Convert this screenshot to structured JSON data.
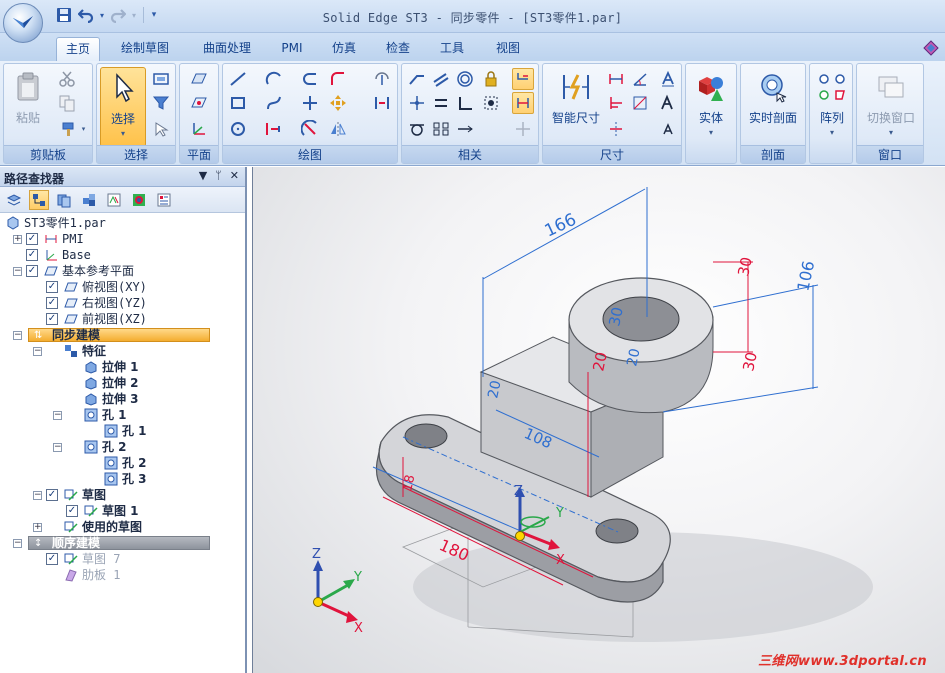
{
  "window": {
    "title": "Solid Edge ST3 - 同步零件 - [ST3零件1.par]"
  },
  "tabs": [
    {
      "label": "主页",
      "active": true
    },
    {
      "label": "绘制草图"
    },
    {
      "label": "曲面处理"
    },
    {
      "label": "PMI"
    },
    {
      "label": "仿真"
    },
    {
      "label": "检查"
    },
    {
      "label": "工具"
    },
    {
      "label": "视图"
    }
  ],
  "ribbon": {
    "clipboard": {
      "label": "剪贴板",
      "paste": "粘贴"
    },
    "select": {
      "label": "选择",
      "select": "选择"
    },
    "plane": {
      "label": "平面"
    },
    "draw": {
      "label": "绘图"
    },
    "relate": {
      "label": "相关"
    },
    "dimension": {
      "label": "尺寸",
      "smart": "智能尺寸"
    },
    "solid": {
      "label": "实体"
    },
    "section": {
      "label": "剖面",
      "live": "实时剖面"
    },
    "pattern": {
      "label": "阵列"
    },
    "window": {
      "label": "窗口",
      "switch": "切换窗口"
    }
  },
  "pathfinder": {
    "title": "路径查找器",
    "controls": [
      "▼",
      "ᛘ",
      "✕"
    ],
    "tree": [
      {
        "label": "ST3零件1.par",
        "indent": 0,
        "icon": "part-icon"
      },
      {
        "label": "PMI",
        "indent": 1,
        "exp": "+",
        "check": true,
        "icon": "pmi-icon"
      },
      {
        "label": "Base",
        "indent": 1,
        "check": true,
        "icon": "coord-icon"
      },
      {
        "label": "基本参考平面",
        "indent": 1,
        "exp": "−",
        "check": true,
        "icon": "plane-icon"
      },
      {
        "label": "俯视图(XY)",
        "indent": 2,
        "check": true,
        "icon": "plane-icon"
      },
      {
        "label": "右视图(YZ)",
        "indent": 2,
        "check": true,
        "icon": "plane-icon"
      },
      {
        "label": "前视图(XZ)",
        "indent": 2,
        "check": true,
        "icon": "plane-icon"
      },
      {
        "label": "同步建模",
        "indent": 1,
        "exp": "−",
        "band": "sync"
      },
      {
        "label": "特征",
        "indent": 2,
        "exp": "−",
        "icon": "features-icon",
        "bold": true
      },
      {
        "label": "拉伸 1",
        "indent": 3,
        "icon": "extrude-icon",
        "bold": true
      },
      {
        "label": "拉伸 2",
        "indent": 3,
        "icon": "extrude-icon",
        "bold": true
      },
      {
        "label": "拉伸 3",
        "indent": 3,
        "icon": "extrude-icon",
        "bold": true
      },
      {
        "label": "孔 1",
        "indent": 3,
        "exp": "−",
        "icon": "hole-icon",
        "bold": true
      },
      {
        "label": "孔 1",
        "indent": 4,
        "icon": "hole-icon",
        "bold": true
      },
      {
        "label": "孔 2",
        "indent": 3,
        "exp": "−",
        "icon": "hole-icon",
        "bold": true
      },
      {
        "label": "孔 2",
        "indent": 4,
        "icon": "hole-icon",
        "bold": true
      },
      {
        "label": "孔 3",
        "indent": 4,
        "icon": "hole-icon",
        "bold": true
      },
      {
        "label": "草图",
        "indent": 2,
        "exp": "−",
        "check": true,
        "icon": "sketch-icon",
        "bold": true
      },
      {
        "label": "草图 1",
        "indent": 3,
        "check": true,
        "icon": "sketch-icon",
        "bold": true
      },
      {
        "label": "使用的草图",
        "indent": 2,
        "exp": "+",
        "icon": "sketch-icon",
        "bold": true
      },
      {
        "label": "顺序建模",
        "indent": 1,
        "exp": "−",
        "band": "seq"
      },
      {
        "label": "草图 7",
        "indent": 2,
        "check": true,
        "icon": "sketch-icon",
        "dim": true
      },
      {
        "label": "肋板 1",
        "indent": 2,
        "icon": "rib-icon",
        "dim": true
      }
    ]
  },
  "viewport": {
    "dimensions": [
      "166",
      "106",
      "30",
      "30",
      "30",
      "20",
      "20",
      "20",
      "108",
      "180",
      "18"
    ],
    "axes": {
      "x": "X",
      "y": "Y",
      "z": "Z"
    },
    "watermark": "三维网www.3dportal.cn"
  },
  "colors": {
    "accent": "#ffc24a",
    "dimension_blue": "#2f6fd0",
    "dimension_red": "#e0143c"
  }
}
